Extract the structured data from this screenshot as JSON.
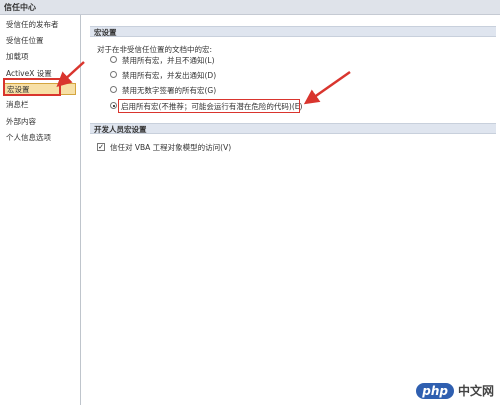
{
  "window": {
    "title": "信任中心"
  },
  "sidebar": {
    "items": [
      {
        "label": "受信任的发布者"
      },
      {
        "label": "受信任位置"
      },
      {
        "label": "加载项"
      },
      {
        "label": "ActiveX 设置"
      },
      {
        "label": "宏设置",
        "selected": true
      },
      {
        "label": "消息栏"
      },
      {
        "label": "外部内容"
      },
      {
        "label": "个人信息选项"
      }
    ]
  },
  "macro_settings": {
    "header": "宏设置",
    "prompt": "对于在非受信任位置的文档中的宏:",
    "options": [
      {
        "label": "禁用所有宏，并且不通知(L)",
        "selected": false
      },
      {
        "label": "禁用所有宏，并发出通知(D)",
        "selected": false
      },
      {
        "label": "禁用无数字签署的所有宏(G)",
        "selected": false
      },
      {
        "label": "启用所有宏(不推荐；可能会运行有潜在危险的代码)(E)",
        "selected": true
      }
    ]
  },
  "developer_macro_settings": {
    "header": "开发人员宏设置",
    "trust_vba": {
      "label": "信任对 VBA 工程对象模型的访问(V)",
      "checked": true
    }
  },
  "watermark": {
    "logo": "php",
    "text": "中文网"
  },
  "colors": {
    "highlight": "#d9352e",
    "selected_bg": "#f7e0a6",
    "section_bg": "#dfe5ef"
  }
}
